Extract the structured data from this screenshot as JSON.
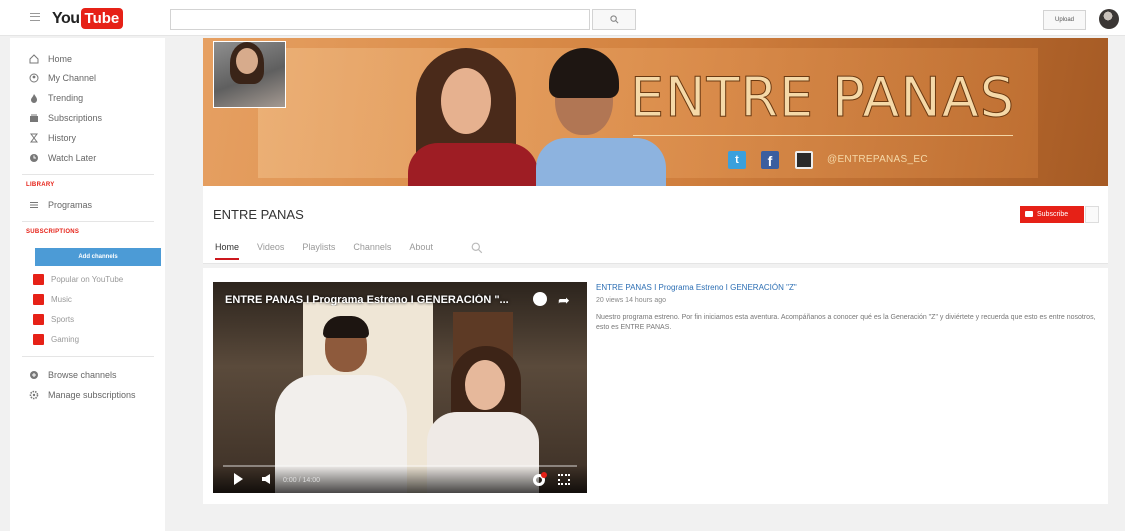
{
  "header": {
    "logo_you": "You",
    "logo_tube": "Tube",
    "search_placeholder": "",
    "upload_label": "Upload"
  },
  "sidebar": {
    "nav": [
      {
        "label": "Home",
        "icon": "home-icon"
      },
      {
        "label": "My Channel",
        "icon": "person-icon"
      },
      {
        "label": "Trending",
        "icon": "flame-icon"
      },
      {
        "label": "Subscriptions",
        "icon": "subscriptions-icon"
      },
      {
        "label": "History",
        "icon": "hourglass-icon"
      },
      {
        "label": "Watch Later",
        "icon": "clock-icon"
      }
    ],
    "library_title": "LIBRARY",
    "library": [
      {
        "label": "Programas",
        "icon": "list-icon"
      }
    ],
    "subscriptions_title": "SUBSCRIPTIONS",
    "add_channels_label": "Add channels",
    "subscriptions": [
      {
        "label": "Popular on YouTube",
        "color": "#e62117"
      },
      {
        "label": "Music",
        "color": "#e62117"
      },
      {
        "label": "Sports",
        "color": "#e62117"
      },
      {
        "label": "Gaming",
        "color": "#e62117"
      }
    ],
    "bottom": [
      {
        "label": "Browse channels",
        "icon": "plus-circle-icon"
      },
      {
        "label": "Manage subscriptions",
        "icon": "gear-icon"
      }
    ]
  },
  "banner": {
    "title": "ENTRE PANAS",
    "handle": "@ENTREPANAS_EC",
    "twitter_glyph": "t",
    "facebook_glyph": "f"
  },
  "channel": {
    "name": "ENTRE PANAS",
    "subscribe_label": "Subscribe",
    "tabs": [
      "Home",
      "Videos",
      "Playlists",
      "Channels",
      "About"
    ],
    "active_tab": "Home"
  },
  "featured_video": {
    "overlay_title": "ENTRE PANAS I Programa Estreno I GENERACIÓN \"...",
    "title": "ENTRE PANAS I Programa Estreno I GENERACIÓN \"Z\"",
    "meta": "20 views 14 hours ago",
    "description": "Nuestro programa estreno. Por fin iniciamos esta aventura. Acompáñanos a conocer qué es la Generación \"Z\" y diviértete y recuerda que esto es entre nosotros, esto es ENTRE PANAS.",
    "time": "0:00 / 14:00",
    "progress": 0.0
  },
  "colors": {
    "brand_red": "#e62117",
    "link_blue": "#2d6fb4",
    "add_channels_blue": "#4c9bd6"
  }
}
